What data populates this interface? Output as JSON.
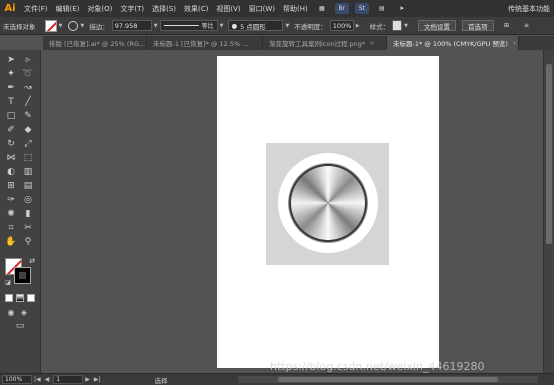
{
  "app": {
    "logo": "Ai",
    "workspace_label": "传统基本功能"
  },
  "menu": [
    "文件(F)",
    "编辑(E)",
    "对象(O)",
    "文字(T)",
    "选择(S)",
    "效果(C)",
    "视图(V)",
    "窗口(W)",
    "帮助(H)"
  ],
  "menu_icons": {
    "br": "Br",
    "st": "St"
  },
  "control": {
    "selection_label": "未选择对象",
    "stroke_label": "描边：",
    "stroke_value": "97.958",
    "profile_label": "等比",
    "brush_label": "5 点圆形",
    "opacity_label": "不透明度：",
    "opacity_value": "100%",
    "style_label": "样式：",
    "doc_setup_label": "文档设置",
    "prefs_label": "首选项"
  },
  "tabs": [
    {
      "label": "排版 [已恢复].ai* @ 25% (RG..."
    },
    {
      "label": "未标题-1 [已恢复]* @ 12.5% ..."
    },
    {
      "label": "渐变旋转工具案例icon过程.png*"
    },
    {
      "label": "未标题-1* @ 100% (CMYK/GPU 预览)"
    }
  ],
  "status": {
    "zoom": "100%",
    "page": "1",
    "tool_text": "选择"
  },
  "watermark": "https://blog.csdn.net/weixin_44619280",
  "colors": {
    "accent": "#ff9a00",
    "fill_none_slash": "#e02020",
    "artboard": "#ffffff",
    "shape_square": "#d4d5d6"
  }
}
